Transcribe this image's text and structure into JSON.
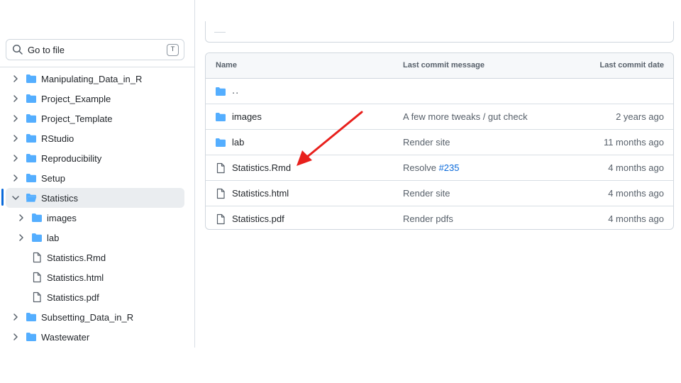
{
  "search": {
    "placeholder": "Go to file",
    "shortcut": "T"
  },
  "sidebar": {
    "items": [
      {
        "label": "Manipulating_Data_in_R",
        "type": "folder",
        "expanded": false,
        "level": 0
      },
      {
        "label": "Project_Example",
        "type": "folder",
        "expanded": false,
        "level": 0
      },
      {
        "label": "Project_Template",
        "type": "folder",
        "expanded": false,
        "level": 0
      },
      {
        "label": "RStudio",
        "type": "folder",
        "expanded": false,
        "level": 0
      },
      {
        "label": "Reproducibility",
        "type": "folder",
        "expanded": false,
        "level": 0
      },
      {
        "label": "Setup",
        "type": "folder",
        "expanded": false,
        "level": 0
      },
      {
        "label": "Statistics",
        "type": "folder",
        "expanded": true,
        "level": 0,
        "selected": true
      },
      {
        "label": "images",
        "type": "folder",
        "expanded": false,
        "level": 1
      },
      {
        "label": "lab",
        "type": "folder",
        "expanded": false,
        "level": 1
      },
      {
        "label": "Statistics.Rmd",
        "type": "file",
        "level": 1
      },
      {
        "label": "Statistics.html",
        "type": "file",
        "level": 1
      },
      {
        "label": "Statistics.pdf",
        "type": "file",
        "level": 1
      },
      {
        "label": "Subsetting_Data_in_R",
        "type": "folder",
        "expanded": false,
        "level": 0
      },
      {
        "label": "Wastewater",
        "type": "folder",
        "expanded": false,
        "level": 0
      }
    ]
  },
  "table": {
    "headers": {
      "name": "Name",
      "message": "Last commit message",
      "date": "Last commit date"
    },
    "parent_label": "..",
    "rows": [
      {
        "name": "images",
        "type": "folder",
        "message": "A few more tweaks / gut check",
        "date": "2 years ago"
      },
      {
        "name": "lab",
        "type": "folder",
        "message": "Render site",
        "date": "11 months ago"
      },
      {
        "name": "Statistics.Rmd",
        "type": "file",
        "message": "Resolve ",
        "message_link": "#235",
        "date": "4 months ago"
      },
      {
        "name": "Statistics.html",
        "type": "file",
        "message": "Render site",
        "date": "4 months ago"
      },
      {
        "name": "Statistics.pdf",
        "type": "file",
        "message": "Render pdfs",
        "date": "4 months ago"
      }
    ]
  },
  "colors": {
    "folder": "#54aeff",
    "folder_open": "#54aeff",
    "link": "#0969da",
    "annotation_arrow": "#e8201c",
    "selected_bg": "#eaedf0",
    "selected_bar": "#0969da"
  },
  "icons": {
    "search": "search-icon",
    "folder": "folder-icon",
    "folder_open": "folder-open-icon",
    "file": "file-icon",
    "chevron_right": "chevron-right-icon",
    "chevron_down": "chevron-down-icon"
  }
}
